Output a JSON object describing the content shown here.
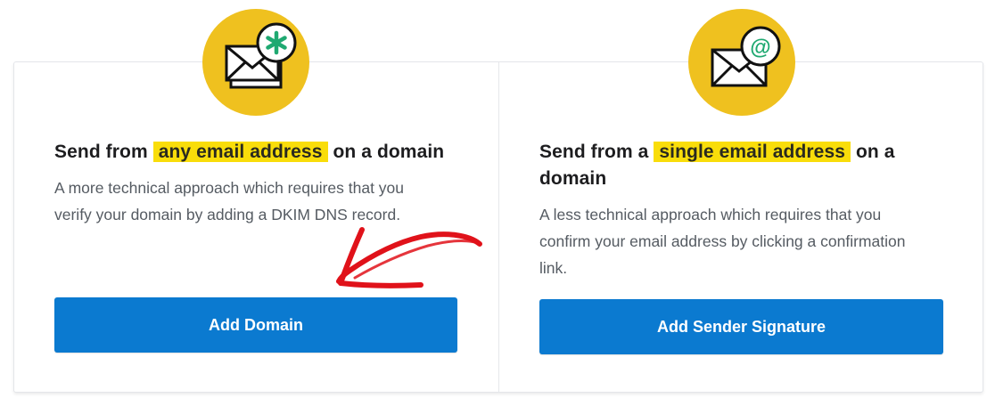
{
  "options": [
    {
      "icon": "envelopes-asterisk-icon",
      "title_prefix": "Send from",
      "title_highlight": "any email address",
      "title_suffix": "on a domain",
      "description_line1": "A more technical approach which requires that you",
      "description_line2": "verify your domain by adding a DKIM DNS record.",
      "button_label": "Add Domain"
    },
    {
      "icon": "envelope-at-sign-icon",
      "title_prefix": "Send from a",
      "title_highlight": "single email address",
      "title_suffix": "on a",
      "title_line2": "domain",
      "description_line1": "A less technical approach which requires that you",
      "description_line2": "confirm your email address by clicking a confirmation",
      "description_line3": "link.",
      "button_label": "Add Sender Signature"
    }
  ],
  "colors": {
    "badge": "#efc11f",
    "highlight": "#f9dd0a",
    "button": "#0b7ad0",
    "annotation_arrow": "#e0121a",
    "asterisk": "#1fa971"
  },
  "annotation": {
    "icon": "hand-drawn-arrow-icon",
    "points_to": "Add Domain"
  }
}
